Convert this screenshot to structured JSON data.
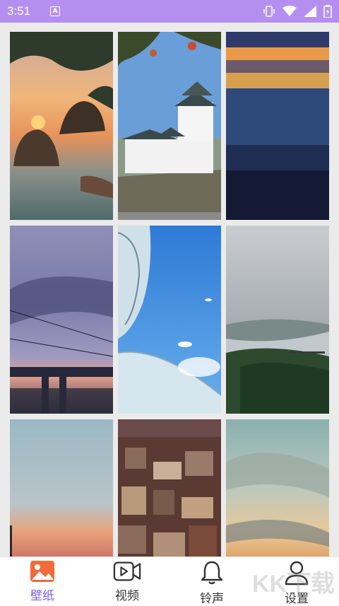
{
  "status_bar": {
    "time": "3:51",
    "notification_icon_letter": "A"
  },
  "wallpapers": [
    {
      "name": "sunset-rocks"
    },
    {
      "name": "japanese-castle"
    },
    {
      "name": "dusk-horizon"
    },
    {
      "name": "bridge-sky"
    },
    {
      "name": "anime-sky"
    },
    {
      "name": "river-valley"
    },
    {
      "name": "pier-sunset"
    },
    {
      "name": "old-town"
    },
    {
      "name": "cloud-sunset"
    }
  ],
  "tabs": [
    {
      "label": "壁纸",
      "icon": "image-icon",
      "active": true
    },
    {
      "label": "视频",
      "icon": "video-icon",
      "active": false
    },
    {
      "label": "铃声",
      "icon": "bell-icon",
      "active": false
    },
    {
      "label": "设置",
      "icon": "person-icon",
      "active": false
    }
  ],
  "watermark": "KK下载",
  "colors": {
    "status_bar": "#b58ff0",
    "active_tab": "#7b5ff0",
    "grid_bg": "#ebebeb"
  }
}
